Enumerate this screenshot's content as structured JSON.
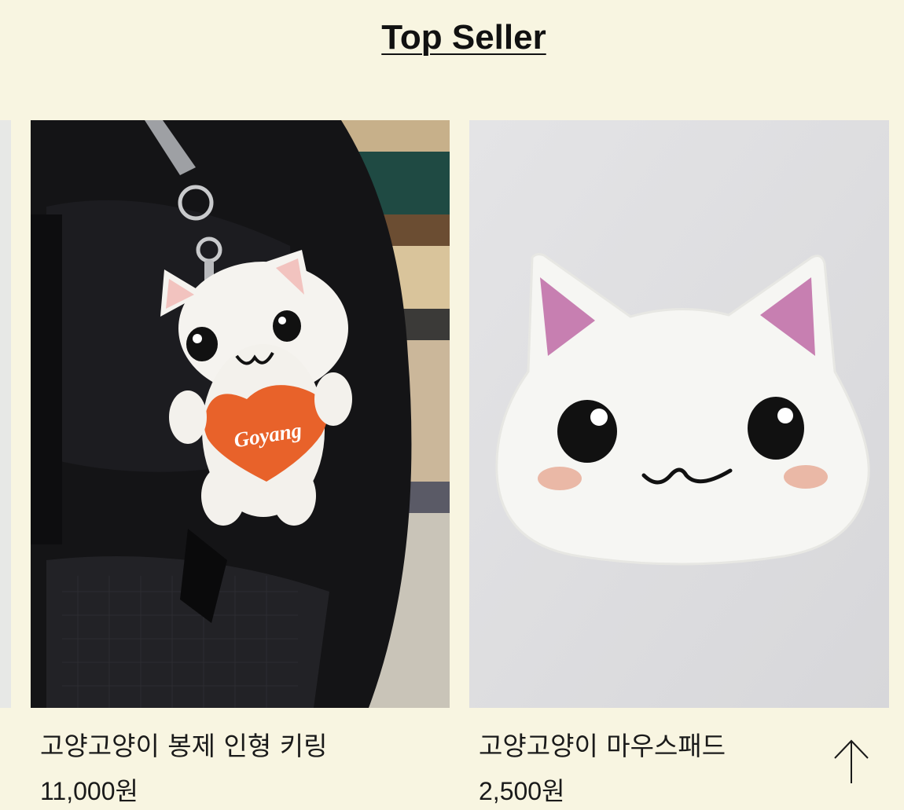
{
  "section": {
    "title": "Top Seller"
  },
  "products": [
    {
      "name": "고양고양이 봉제 인형 키링",
      "price": "11,000원",
      "image_text": "Goyang"
    },
    {
      "name": "고양고양이 마우스패드",
      "price": "2,500원"
    }
  ],
  "colors": {
    "background": "#f8f5e1",
    "keyring_heart": "#e8622a",
    "cat_ear_pink": "#c77fb1",
    "cheek_blush": "#eab8a6"
  },
  "icons": {
    "scroll_top": "arrow-up-icon"
  }
}
